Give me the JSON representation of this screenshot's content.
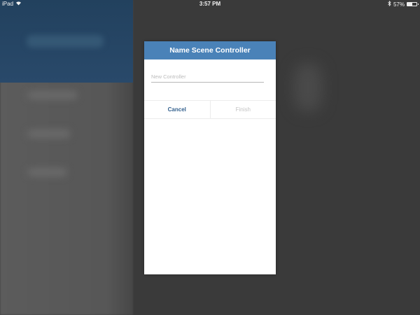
{
  "status_bar": {
    "device": "iPad",
    "time": "3:57 PM",
    "battery": "57%",
    "battery_level": 0.57,
    "icons": [
      "wifi-icon",
      "bluetooth-icon",
      "battery-icon"
    ]
  },
  "dialog": {
    "title": "Name Scene Controller",
    "name_input": {
      "value": "",
      "placeholder": "New Controller"
    },
    "cancel_label": "Cancel",
    "finish_label": "Finish",
    "finish_enabled": false
  },
  "colors": {
    "header": "#4a82b8",
    "cancel_text": "#35628f",
    "finish_disabled_text": "#c3c3c3",
    "backdrop": "#3a3a3a"
  }
}
